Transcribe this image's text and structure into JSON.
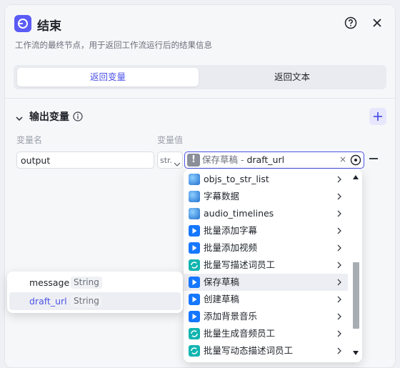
{
  "header": {
    "title": "结束",
    "subtitle": "工作流的最终节点，用于返回工作流运行后的结果信息"
  },
  "tabs": [
    {
      "label": "返回变量",
      "active": true
    },
    {
      "label": "返回文本",
      "active": false
    }
  ],
  "section": {
    "title": "输出变量"
  },
  "columns": {
    "name": "变量名",
    "value": "变量值"
  },
  "variable": {
    "name": "output",
    "type": "str.",
    "ref_node": "保存草稿",
    "ref_separator": " - ",
    "ref_field": "draft_url"
  },
  "node_list": [
    {
      "label": "objs_to_str_list",
      "icon": "globe-icon"
    },
    {
      "label": "字幕数据",
      "icon": "globe-icon"
    },
    {
      "label": "audio_timelines",
      "icon": "globe-icon"
    },
    {
      "label": "批量添加字幕",
      "icon": "play-icon"
    },
    {
      "label": "批量添加视频",
      "icon": "play-icon"
    },
    {
      "label": "批量写描述词员工",
      "icon": "loop-icon"
    },
    {
      "label": "保存草稿",
      "icon": "play-icon"
    },
    {
      "label": "创建草稿",
      "icon": "play-icon"
    },
    {
      "label": "添加背景音乐",
      "icon": "play-icon"
    },
    {
      "label": "批量生成音频员工",
      "icon": "loop-icon"
    },
    {
      "label": "批量写动态描述词员工",
      "icon": "loop-icon"
    }
  ],
  "field_list": [
    {
      "name": "message",
      "type": "String"
    },
    {
      "name": "draft_url",
      "type": "String"
    }
  ],
  "colors": {
    "accent": "#4d53e8",
    "play_icon": "#1677ff",
    "loop_icon": "#12b5b0"
  }
}
